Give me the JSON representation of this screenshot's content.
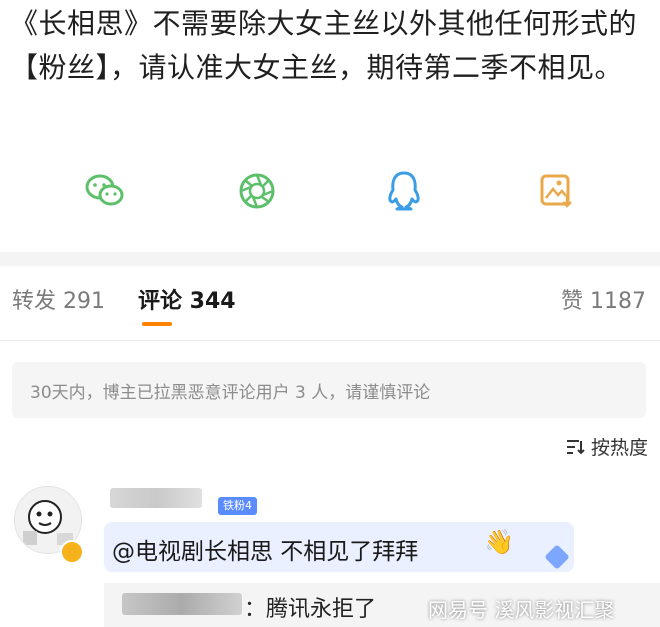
{
  "post": {
    "text": "《长相思》不需要除大女主丝以外其他任何形式的【粉丝】，请认准大女主丝，期待第二季不相见。"
  },
  "share": {
    "items": [
      {
        "icon": "wechat-icon",
        "color": "#5cc06a"
      },
      {
        "icon": "moments-icon",
        "color": "#5cc06a"
      },
      {
        "icon": "qq-icon",
        "color": "#3b9de4"
      },
      {
        "icon": "save-image-icon",
        "color": "#e9a94a"
      }
    ]
  },
  "tabs": {
    "repost": "转发 291",
    "comment": "评论 344",
    "like": "赞 1187"
  },
  "notice": {
    "text": "30天内，博主已拉黑恶意评论用户 3 人，请谨慎评论"
  },
  "sort": {
    "label": "按热度"
  },
  "comment": {
    "fan_badge": "铁粉4",
    "text": "@电视剧长相思 不相见了拜拜"
  },
  "reply": {
    "text": "：腾讯永拒了"
  },
  "watermark": {
    "text": "网易号 溪风影视汇聚"
  }
}
